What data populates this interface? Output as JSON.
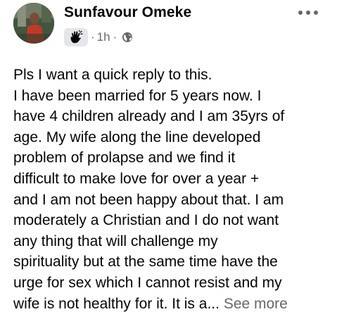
{
  "post": {
    "author": "Sunfavour Omeke",
    "time": "1h",
    "separator1": "·",
    "separator2": "·",
    "badge_icon": "raised-hand-icon",
    "audience_icon": "globe-icon",
    "menu_icon": "more-options-icon",
    "lines": [
      "Pls I want a quick reply to this.",
      "I have been married for 5 years now. I",
      "have 4 children already and I am 35yrs of",
      "age. My wife along the line developed",
      "problem of prolapse and we find it",
      "difficult to make love for over a year +",
      "and I am not been happy about that. I am",
      "moderately a Christian and I do not want",
      "any thing that will challenge my",
      "spirituality but at the same time have the",
      "urge for sex which I cannot resist and my",
      "wife is not healthy for it. It is a..."
    ],
    "see_more": "See more"
  },
  "colors": {
    "text": "#050505",
    "secondary": "#65676b",
    "badge_bg": "#e4e6eb"
  }
}
